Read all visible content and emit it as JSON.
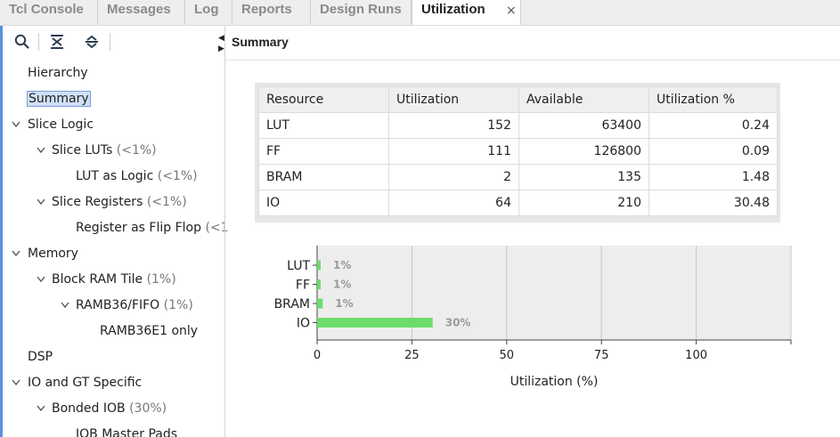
{
  "tabs": [
    {
      "label": "Tcl Console"
    },
    {
      "label": "Messages"
    },
    {
      "label": "Log"
    },
    {
      "label": "Reports"
    },
    {
      "label": "Design Runs"
    },
    {
      "label": "Utilization",
      "active": true
    }
  ],
  "tab_close": "×",
  "icons": {
    "search": "search-icon",
    "collapse_all": "collapse-all-icon",
    "expand_all": "expand-all-icon",
    "collapse_panel": "collapse-panel-icon"
  },
  "tree": [
    {
      "label": "Hierarchy",
      "pct": ""
    },
    {
      "label": "Summary",
      "pct": "",
      "selected": true
    },
    {
      "label": "Slice Logic",
      "pct": ""
    },
    {
      "label": "Slice LUTs",
      "pct": "(<1%)"
    },
    {
      "label": "LUT as Logic",
      "pct": "(<1%)"
    },
    {
      "label": "Slice Registers",
      "pct": "(<1%)"
    },
    {
      "label": "Register as Flip Flop",
      "pct": "(<1"
    },
    {
      "label": "Memory",
      "pct": ""
    },
    {
      "label": "Block RAM Tile",
      "pct": "(1%)"
    },
    {
      "label": "RAMB36/FIFO",
      "pct": "(1%)"
    },
    {
      "label": "RAMB36E1 only",
      "pct": ""
    },
    {
      "label": "DSP",
      "pct": ""
    },
    {
      "label": "IO and GT Specific",
      "pct": ""
    },
    {
      "label": "Bonded IOB",
      "pct": "(30%)"
    },
    {
      "label": "IOB Master Pads",
      "pct": ""
    }
  ],
  "panel_title": "Summary",
  "table": {
    "headers": [
      "Resource",
      "Utilization",
      "Available",
      "Utilization %"
    ],
    "rows": [
      [
        "LUT",
        "152",
        "63400",
        "0.24"
      ],
      [
        "FF",
        "111",
        "126800",
        "0.09"
      ],
      [
        "BRAM",
        "2",
        "135",
        "1.48"
      ],
      [
        "IO",
        "64",
        "210",
        "30.48"
      ]
    ]
  },
  "colors": {
    "bar": "#6ddc6d",
    "accent": "#5b8fd8",
    "selected_bg": "#cfe0f7"
  },
  "chart_data": {
    "type": "bar",
    "orientation": "horizontal",
    "categories": [
      "LUT",
      "FF",
      "BRAM",
      "IO"
    ],
    "values": [
      0.24,
      0.09,
      1.48,
      30.48
    ],
    "data_labels": [
      "1%",
      "1%",
      "1%",
      "30%"
    ],
    "xlim": [
      0,
      125
    ],
    "xticks": [
      "0",
      "25",
      "50",
      "75",
      "100"
    ],
    "xlabel": "Utilization (%)",
    "grid": true
  }
}
